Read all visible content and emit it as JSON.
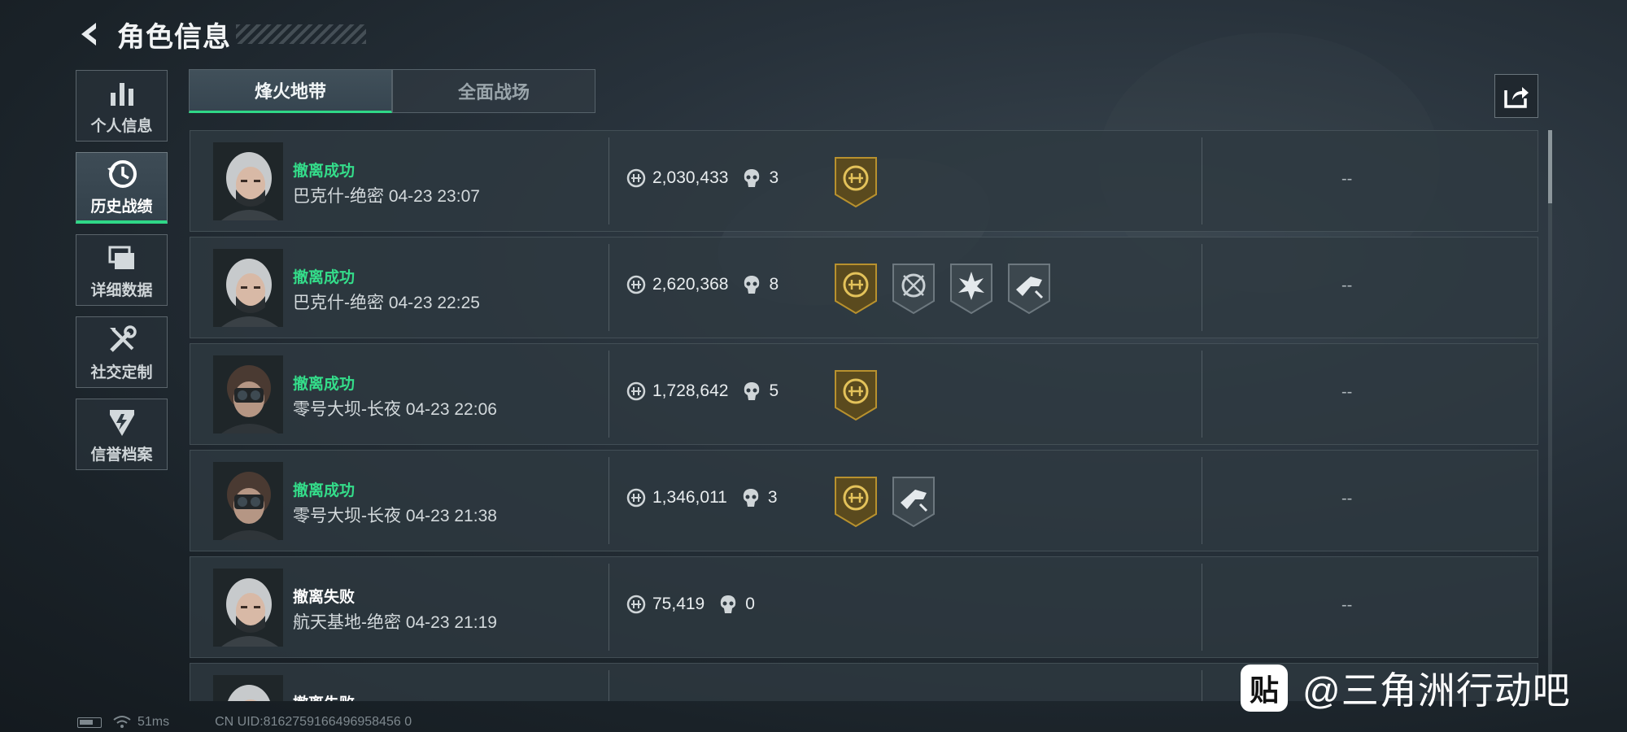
{
  "header": {
    "title": "角色信息"
  },
  "sidebar": {
    "items": [
      {
        "label": "个人信息",
        "icon": "bar-chart-icon",
        "active": false
      },
      {
        "label": "历史战绩",
        "icon": "history-clock-icon",
        "active": true
      },
      {
        "label": "详细数据",
        "icon": "stacked-windows-icon",
        "active": false
      },
      {
        "label": "社交定制",
        "icon": "tools-icon",
        "active": false
      },
      {
        "label": "信誉档案",
        "icon": "shield-emblem-icon",
        "active": false
      }
    ]
  },
  "tabs": [
    {
      "label": "烽火地带",
      "active": true
    },
    {
      "label": "全面战场",
      "active": false
    }
  ],
  "share": {
    "icon": "share-icon"
  },
  "matches": [
    {
      "result": "撤离成功",
      "status": "success",
      "map_time": "巴克什-绝密 04-23 23:07",
      "value": "2,030,433",
      "kills": "3",
      "badges": [
        "gold-coin-badge-icon"
      ],
      "extra": "--",
      "avatar": "female-operator-avatar"
    },
    {
      "result": "撤离成功",
      "status": "success",
      "map_time": "巴克什-绝密 04-23 22:25",
      "value": "2,620,368",
      "kills": "8",
      "badges": [
        "gold-coin-badge-icon",
        "crosshair-badge-icon",
        "explosion-badge-icon",
        "weapon-badge-icon"
      ],
      "extra": "--",
      "avatar": "female-operator-avatar"
    },
    {
      "result": "撤离成功",
      "status": "success",
      "map_time": "零号大坝-长夜 04-23 22:06",
      "value": "1,728,642",
      "kills": "5",
      "badges": [
        "gold-coin-badge-icon"
      ],
      "extra": "--",
      "avatar": "nightvision-operator-avatar"
    },
    {
      "result": "撤离成功",
      "status": "success",
      "map_time": "零号大坝-长夜 04-23 21:38",
      "value": "1,346,011",
      "kills": "3",
      "badges": [
        "gold-coin-badge-icon",
        "weapon-badge-icon"
      ],
      "extra": "--",
      "avatar": "nightvision-operator-avatar"
    },
    {
      "result": "撤离失败",
      "status": "fail",
      "map_time": "航天基地-绝密 04-23 21:19",
      "value": "75,419",
      "kills": "0",
      "badges": [],
      "extra": "--",
      "avatar": "female-operator-avatar"
    },
    {
      "result": "撤离失败",
      "status": "fail",
      "map_time": "",
      "value": "",
      "kills": "",
      "badges": [],
      "extra": "",
      "avatar": "female-operator-avatar"
    }
  ],
  "footer": {
    "ping": "51ms",
    "uid": "CN UID:8162759166496958456 0"
  },
  "watermark": {
    "logo_text": "贴",
    "text": "@三角洲行动吧"
  },
  "colors": {
    "success": "#34dd8a",
    "accent": "#2fd787",
    "gold": "#b8912e"
  }
}
